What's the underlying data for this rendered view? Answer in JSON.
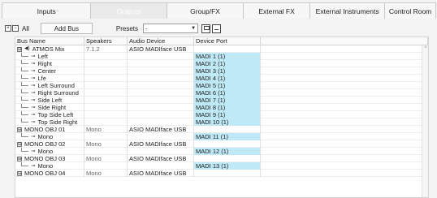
{
  "tabs": [
    {
      "label": "Inputs",
      "active": false
    },
    {
      "label": "Outputs",
      "active": true
    },
    {
      "label": "Group/FX",
      "active": false
    },
    {
      "label": "External FX",
      "active": false
    },
    {
      "label": "External Instruments",
      "active": false
    },
    {
      "label": "Control Room",
      "active": false
    }
  ],
  "toolbar": {
    "expand_icon": "expand-all-icon",
    "collapse_icon": "collapse-all-icon",
    "all_label": "All",
    "add_bus_label": "Add Bus",
    "presets_label": "Presets",
    "presets_value": "-",
    "save_icon": "save-preset-icon",
    "delete_icon": "delete-preset-icon"
  },
  "table": {
    "columns": [
      "Bus Name",
      "Speakers",
      "Audio Device",
      "Device Port"
    ],
    "rows": [
      {
        "type": "bus",
        "expander": "⊟",
        "icon": "speaker-icon",
        "name": "ATMOS Mix",
        "speakers": "7.1.2",
        "device": "ASIO MADIface USB",
        "port": ""
      },
      {
        "type": "channel",
        "name": "Left",
        "speakers": "",
        "device": "",
        "port": "MADI 1 (1)"
      },
      {
        "type": "channel",
        "name": "Right",
        "speakers": "",
        "device": "",
        "port": "MADI 2 (1)"
      },
      {
        "type": "channel",
        "name": "Center",
        "speakers": "",
        "device": "",
        "port": "MADI 3 (1)"
      },
      {
        "type": "channel",
        "name": "Lfe",
        "speakers": "",
        "device": "",
        "port": "MADI 4 (1)"
      },
      {
        "type": "channel",
        "name": "Left Surround",
        "speakers": "",
        "device": "",
        "port": "MADI 5 (1)"
      },
      {
        "type": "channel",
        "name": "Right Surround",
        "speakers": "",
        "device": "",
        "port": "MADI 6 (1)"
      },
      {
        "type": "channel",
        "name": "Side Left",
        "speakers": "",
        "device": "",
        "port": "MADI 7 (1)"
      },
      {
        "type": "channel",
        "name": "Side Right",
        "speakers": "",
        "device": "",
        "port": "MADI 8 (1)"
      },
      {
        "type": "channel",
        "name": "Top Side Left",
        "speakers": "",
        "device": "",
        "port": "MADI 9 (1)"
      },
      {
        "type": "channel",
        "name": "Top Side Right",
        "speakers": "",
        "device": "",
        "port": "MADI 10 (1)"
      },
      {
        "type": "bus",
        "expander": "⊟",
        "icon": "",
        "name": "MONO OBJ 01",
        "speakers": "Mono",
        "device": "ASIO MADIface USB",
        "port": ""
      },
      {
        "type": "channel",
        "name": "Mono",
        "speakers": "",
        "device": "",
        "port": "MADI 11 (1)"
      },
      {
        "type": "bus",
        "expander": "⊟",
        "icon": "",
        "name": "MONO OBJ 02",
        "speakers": "Mono",
        "device": "ASIO MADIface USB",
        "port": ""
      },
      {
        "type": "channel",
        "name": "Mono",
        "speakers": "",
        "device": "",
        "port": "MADI 12 (1)"
      },
      {
        "type": "bus",
        "expander": "⊟",
        "icon": "",
        "name": "MONO OBJ 03",
        "speakers": "Mono",
        "device": "ASIO MADIface USB",
        "port": ""
      },
      {
        "type": "channel",
        "name": "Mono",
        "speakers": "",
        "device": "",
        "port": "MADI 13 (1)"
      },
      {
        "type": "bus",
        "expander": "⊟",
        "icon": "",
        "name": "MONO OBJ 04",
        "speakers": "Mono",
        "device": "ASIO MADIface USB",
        "port": ""
      }
    ]
  },
  "colors": {
    "port_highlight": "#bfe9f6",
    "background": "#f3f3f3"
  }
}
